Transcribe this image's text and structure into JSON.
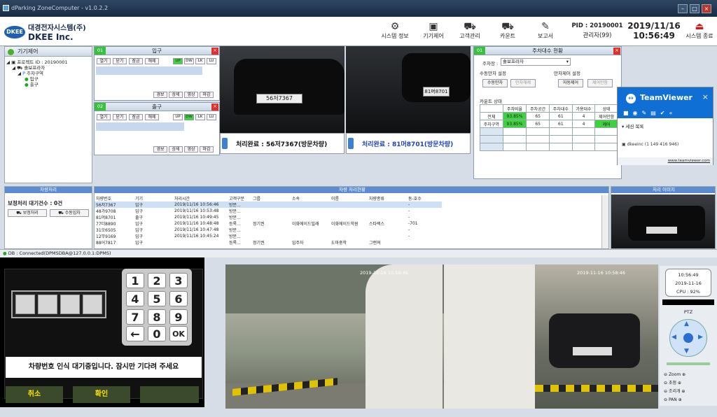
{
  "window": {
    "title": "dParking ZoneComputer - v1.0.2.2"
  },
  "header": {
    "logo_korean": "대경전자시스템(주)",
    "logo_english": "DKEE Inc.",
    "logo_mark": "DKEE",
    "buttons": [
      {
        "label": "시스템 정보",
        "icon": "gear-icon"
      },
      {
        "label": "기기제어",
        "icon": "device-control-icon"
      },
      {
        "label": "고객관리",
        "icon": "customer-icon"
      },
      {
        "label": "카운트",
        "icon": "count-icon"
      },
      {
        "label": "보고서",
        "icon": "report-icon"
      }
    ],
    "pid": "PID : 20190001",
    "admin": "관리자(99)",
    "date": "2019/11/16",
    "time": "10:56:49",
    "exit": "시스템 종료"
  },
  "tree": {
    "title": "기기제어",
    "items": [
      "프로젝트 ID : 20190001",
      "솔보프라자",
      "주차구역",
      "입구",
      "출구"
    ]
  },
  "entrance": {
    "num": "01",
    "title": "입구",
    "buttons": [
      "열기",
      "닫기",
      "잠금",
      "해제"
    ],
    "toggles": [
      "UP",
      "DW",
      "LK",
      "LU"
    ],
    "bottom": [
      "경보",
      "상세",
      "영상",
      "마감"
    ]
  },
  "exit_panel": {
    "num": "02",
    "title": "출구",
    "buttons": [
      "열기",
      "닫기",
      "잠금",
      "해제"
    ],
    "toggles": [
      "UP",
      "DW",
      "LK",
      "LU"
    ],
    "bottom": [
      "경보",
      "상세",
      "영상",
      "마감"
    ]
  },
  "cameras": {
    "plate1": "56저7367",
    "plate2": "81머8701",
    "result1": "처리완료 : 56저7367(방문차량)",
    "result2": "처리완료 : 81머8701(방문차량)"
  },
  "parking": {
    "num": "01",
    "title": "주차대수 현황",
    "lot_label": "주차장 :",
    "lot_value": "솔보프라자",
    "manual_full_label": "수동만차 설정",
    "manual_full_btn": "수동만차",
    "full_release_btn": "만차해제",
    "full_control_label": "만차제어 설정",
    "auto_ctrl_btn": "자동제어",
    "ctrl_release_btn": "제어만함",
    "count_status": "카운트 상태",
    "table_headers": [
      "",
      "주차비율",
      "주차공간",
      "주차대수",
      "가용대수",
      "상태"
    ],
    "rows": [
      [
        "전체",
        "93.85%",
        "65",
        "61",
        "4",
        "제어만함"
      ],
      [
        "주차구역",
        "93.85%",
        "65",
        "61",
        "4",
        "제어"
      ]
    ]
  },
  "teamviewer": {
    "title": "TeamViewer",
    "section": "세션 목록",
    "session": "dkeeinc (1 149 416 946)",
    "url": "www.teamviewer.com"
  },
  "pending": {
    "header": "차량처리",
    "label": "보정처리 대기건수 : 0건",
    "btn_correct": "보정처리",
    "btn_manual": "수동입차"
  },
  "history": {
    "header": "차량 처리현황",
    "columns": [
      "차량번호",
      "기기",
      "처리시간",
      "고객구분",
      "그룹",
      "소속",
      "이름",
      "차량종류",
      "동-호수"
    ],
    "rows": [
      [
        "56저7367",
        "입구",
        "2019/11/16 10:56:46",
        "방문...",
        "",
        "",
        "",
        "",
        "-"
      ],
      [
        "48가9708",
        "입구",
        "2019/11/16 10:53:48",
        "방문...",
        "",
        "",
        "",
        "",
        "-"
      ],
      [
        "81머8701",
        "출구",
        "2019/11/16 10:49:45",
        "방문...",
        "",
        "",
        "",
        "",
        "-"
      ],
      [
        "77더8890",
        "입구",
        "2019/11/16 10:48:48",
        "등록...",
        "정기권",
        "이화에이드빌래",
        "이화에이드학원",
        "스타렉스",
        "-701"
      ],
      [
        "31오6505",
        "입구",
        "2019/11/16 10:47:48",
        "방문...",
        "",
        "",
        "",
        "",
        "-"
      ],
      [
        "12무9169",
        "입구",
        "2019/11/16 10:45:24",
        "방문...",
        "",
        "",
        "",
        "",
        "-"
      ],
      [
        "88어7817",
        "입구",
        "",
        "등록...",
        "정기권",
        "입주자",
        "도마중학",
        "그랜져",
        ""
      ]
    ]
  },
  "image_panel": {
    "header": "처리 이미지"
  },
  "statusbar": {
    "text": "DB : Connected(DPMSDBA@127.0.0.1:DPMS)"
  },
  "kiosk": {
    "keys": [
      "1",
      "2",
      "3",
      "4",
      "5",
      "6",
      "7",
      "8",
      "9",
      "←",
      "0",
      "OK"
    ],
    "message": "차량번호 인식 대기중입니다. 잠시만 기다려 주세요",
    "cancel": "취소",
    "confirm": "확인"
  },
  "cctv": {
    "ts_left": "2019-11-16 10:58:46",
    "ts_right": "2019-11-16 10:58:46"
  },
  "ptz": {
    "time": "10:56:49",
    "date": "2019-11-16",
    "cpu": "CPU : 92%",
    "title": "PTZ",
    "controls": [
      "Zoom",
      "초점",
      "조리개",
      "PAN"
    ]
  }
}
